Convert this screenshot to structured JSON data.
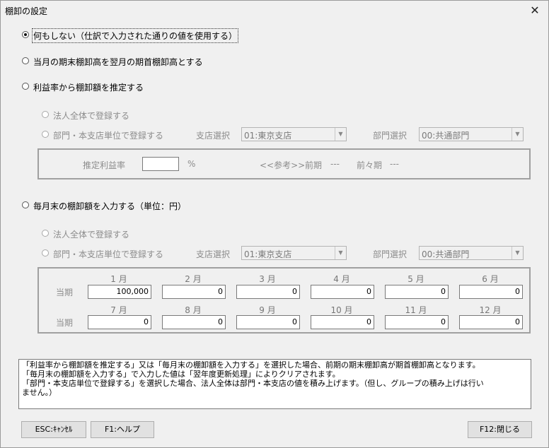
{
  "window": {
    "title": "棚卸の設定",
    "close_glyph": "✕"
  },
  "options": {
    "none": "何もしない（仕訳で入力された通りの値を使用する）",
    "carry_over": "当月の期末棚卸高を翌月の期首棚卸高とする",
    "estimate": "利益率から棚卸額を推定する",
    "monthly": "毎月末の棚卸額を入力する（単位：円）"
  },
  "estimate_section": {
    "corp_whole": "法人全体で登録する",
    "by_dept": "部門・本支店単位で登録する",
    "branch_label": "支店選択",
    "branch_value": "01:東京支店",
    "dept_label": "部門選択",
    "dept_value": "00:共通部門",
    "rate_label": "推定利益率",
    "rate_unit": "%",
    "reference": "<<参考>>",
    "prev_label": "前期",
    "prev_value": "---",
    "prev2_label": "前々期",
    "prev2_value": "---"
  },
  "monthly_section": {
    "corp_whole": "法人全体で登録する",
    "by_dept": "部門・本支店単位で登録する",
    "branch_label": "支店選択",
    "branch_value": "01:東京支店",
    "dept_label": "部門選択",
    "dept_value": "00:共通部門",
    "row_label_1": "当期",
    "row_label_2": "当期",
    "months": [
      "1 月",
      "2 月",
      "3 月",
      "4 月",
      "5 月",
      "6 月",
      "7 月",
      "8 月",
      "9 月",
      "10 月",
      "11 月",
      "12 月"
    ],
    "values": [
      "100,000",
      "0",
      "0",
      "0",
      "0",
      "0",
      "0",
      "0",
      "0",
      "0",
      "0",
      "0"
    ]
  },
  "notes": {
    "line1": "「利益率から棚卸額を推定する」又は「毎月末の棚卸額を入力する」を選択した場合、前期の期末棚卸高が期首棚卸高となります。",
    "line2": "「毎月末の棚卸額を入力する」で入力した値は「翌年度更新処理」によりクリアされます。",
    "line3": "「部門・本支店単位で登録する」を選択した場合、法人全体は部門・本支店の値を積み上げます。（但し、グループの積み上げは行い",
    "line4": "ません。）"
  },
  "buttons": {
    "cancel": "ESC:ｷｬﾝｾﾙ",
    "help": "F1:ヘルプ",
    "close": "F12:閉じる"
  }
}
